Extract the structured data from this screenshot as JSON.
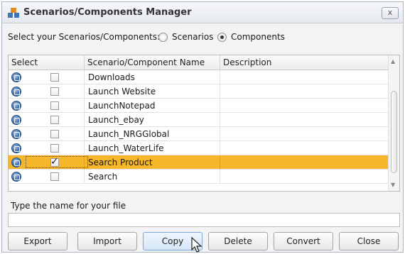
{
  "window": {
    "title": "Scenarios/Components Manager",
    "close_label": "x"
  },
  "selector": {
    "label": "Select your Scenarios/Components:",
    "options": [
      "Scenarios",
      "Components"
    ],
    "selected": "Components"
  },
  "table": {
    "headers": [
      "Select",
      "Scenario/Component Name",
      "Description"
    ],
    "rows": [
      {
        "name": "Downloads",
        "checked": false,
        "description": ""
      },
      {
        "name": "Launch Website",
        "checked": false,
        "description": ""
      },
      {
        "name": "LaunchNotepad",
        "checked": false,
        "description": ""
      },
      {
        "name": "Launch_ebay",
        "checked": false,
        "description": ""
      },
      {
        "name": "Launch_NRGGlobal",
        "checked": false,
        "description": ""
      },
      {
        "name": "Launch_WaterLife",
        "checked": false,
        "description": ""
      },
      {
        "name": "Search Product",
        "checked": true,
        "description": "",
        "selected": true
      },
      {
        "name": "Search",
        "checked": false,
        "description": ""
      }
    ]
  },
  "file": {
    "label": "Type the name for your file",
    "value": ""
  },
  "buttons": {
    "export": "Export",
    "import": "Import",
    "copy": "Copy",
    "delete": "Delete",
    "convert": "Convert",
    "close": "Close"
  },
  "colors": {
    "selected_row": "#f7b72a",
    "row_icon": "#2f5f9c"
  },
  "icons": {
    "app": "components-manager-icon",
    "row": "component-icon",
    "checkmark": "checkmark-icon",
    "cursor": "mouse-pointer-icon"
  }
}
